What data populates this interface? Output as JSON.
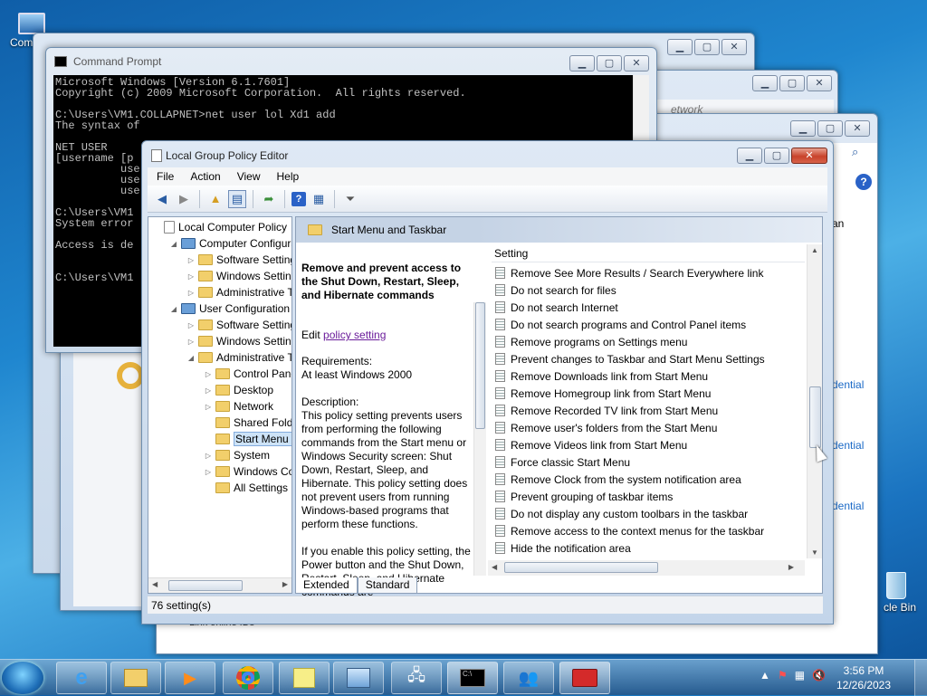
{
  "desktop": {
    "icons": [
      {
        "label": "Comp"
      },
      {
        "label": "cle Bin"
      }
    ]
  },
  "bg_windows": {
    "credential_links": [
      "dential",
      "dential",
      "dential"
    ],
    "partial_texts": {
      "an": "an",
      "online": "Link online IDs"
    },
    "search_hint": "etwork"
  },
  "cmd": {
    "title": "Command Prompt",
    "lines": "Microsoft Windows [Version 6.1.7601]\nCopyright (c) 2009 Microsoft Corporation.  All rights reserved.\n\nC:\\Users\\VM1.COLLAPNET>net user lol Xd1 add\nThe syntax of\n\nNET USER\n[username [p\n          use\n          use\n          use\n\nC:\\Users\\VM1\nSystem error\n\nAccess is de\n\n\nC:\\Users\\VM1"
  },
  "gpe": {
    "title": "Local Group Policy Editor",
    "menu": [
      "File",
      "Action",
      "View",
      "Help"
    ],
    "tree": [
      {
        "label": "Local Computer Policy",
        "level": 0,
        "arrow": "",
        "sel": false
      },
      {
        "label": "Computer Configura",
        "level": 1,
        "arrow": "◢",
        "sel": false
      },
      {
        "label": "Software Settings",
        "level": 2,
        "arrow": "▷",
        "sel": false
      },
      {
        "label": "Windows Settings",
        "level": 2,
        "arrow": "▷",
        "sel": false
      },
      {
        "label": "Administrative Te",
        "level": 2,
        "arrow": "▷",
        "sel": false
      },
      {
        "label": "User Configuration",
        "level": 1,
        "arrow": "◢",
        "sel": false
      },
      {
        "label": "Software Settings",
        "level": 2,
        "arrow": "▷",
        "sel": false
      },
      {
        "label": "Windows Setting",
        "level": 2,
        "arrow": "▷",
        "sel": false
      },
      {
        "label": "Administrative Te",
        "level": 2,
        "arrow": "◢",
        "sel": false
      },
      {
        "label": "Control Panel",
        "level": 3,
        "arrow": "▷",
        "sel": false
      },
      {
        "label": "Desktop",
        "level": 3,
        "arrow": "▷",
        "sel": false
      },
      {
        "label": "Network",
        "level": 3,
        "arrow": "▷",
        "sel": false
      },
      {
        "label": "Shared Folder",
        "level": 3,
        "arrow": "",
        "sel": false
      },
      {
        "label": "Start Menu ar",
        "level": 3,
        "arrow": "",
        "sel": true
      },
      {
        "label": "System",
        "level": 3,
        "arrow": "▷",
        "sel": false
      },
      {
        "label": "Windows Cor",
        "level": 3,
        "arrow": "▷",
        "sel": false
      },
      {
        "label": "All Settings",
        "level": 3,
        "arrow": "",
        "sel": false
      }
    ],
    "pane_header": "Start Menu and Taskbar",
    "desc_title": "Remove and prevent access to the Shut Down, Restart, Sleep, and Hibernate commands",
    "edit_prefix": "Edit ",
    "edit_link": "policy setting",
    "desc_body": "Requirements:\nAt least Windows 2000\n\nDescription:\nThis policy setting prevents users from performing the following commands from the Start menu or Windows Security screen: Shut Down, Restart, Sleep, and Hibernate. This policy setting does not prevent users from running Windows-based programs that perform these functions.\n\nIf you enable this policy setting, the Power button and the Shut Down, Restart, Sleep, and Hibernate commands are",
    "list_header": "Setting",
    "settings": [
      "Remove See More Results / Search Everywhere link",
      "Do not search for files",
      "Do not search Internet",
      "Do not search programs and Control Panel items",
      "Remove programs on Settings menu",
      "Prevent changes to Taskbar and Start Menu Settings",
      "Remove Downloads link from Start Menu",
      "Remove Homegroup link from Start Menu",
      "Remove Recorded TV link from Start Menu",
      "Remove user's folders from the Start Menu",
      "Remove Videos link from Start Menu",
      "Force classic Start Menu",
      "Remove Clock from the system notification area",
      "Prevent grouping of taskbar items",
      "Do not display any custom toolbars in the taskbar",
      "Remove access to the context menus for the taskbar",
      "Hide the notification area"
    ],
    "tabs": [
      "Extended",
      "Standard"
    ],
    "status": "76 setting(s)"
  },
  "taskbar": {
    "time": "3:56 PM",
    "date": "12/26/2023",
    "buttons": [
      "ie",
      "explorer",
      "media",
      "chrome",
      "folders",
      "control-panel",
      "network",
      "cmd",
      "users",
      "toolbox"
    ]
  }
}
